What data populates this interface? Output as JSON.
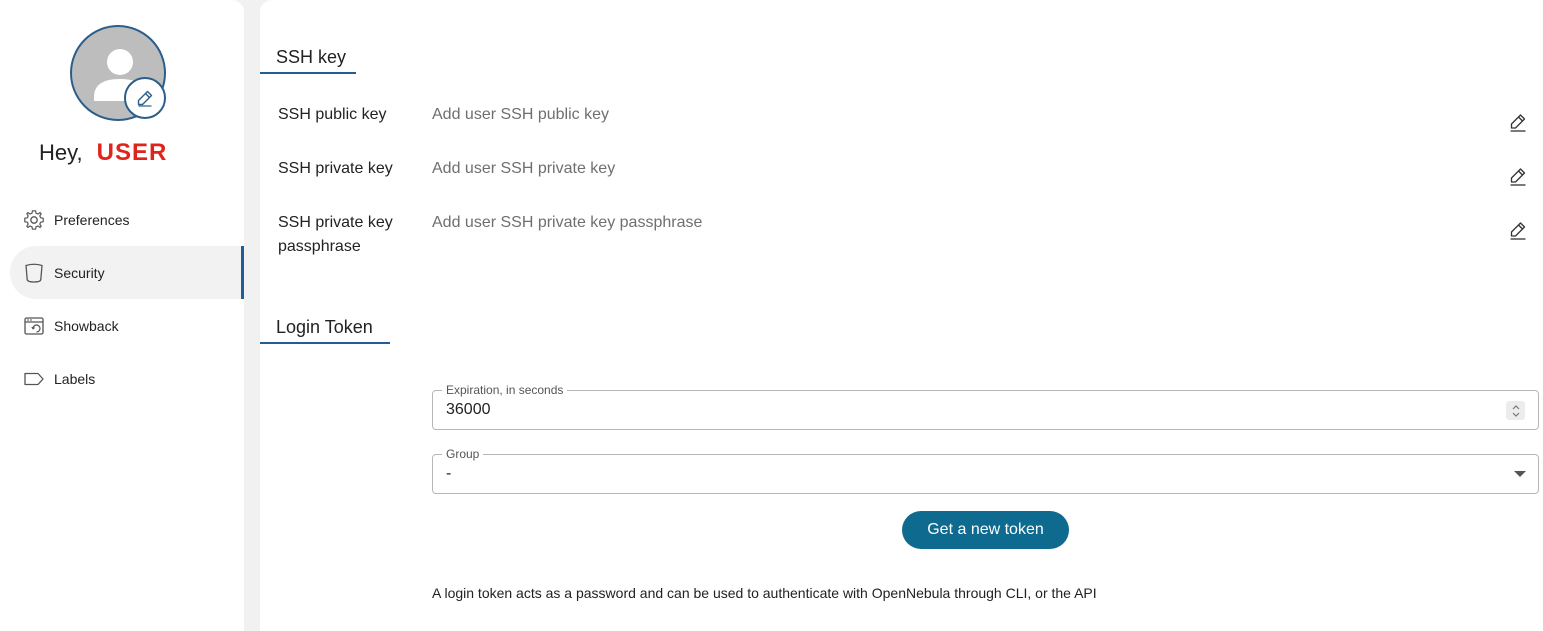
{
  "profile": {
    "greeting": "Hey,",
    "user_name": "USER"
  },
  "sidebar": {
    "items": [
      {
        "label": "Preferences",
        "icon": "gear-icon",
        "active": false
      },
      {
        "label": "Security",
        "icon": "shield-icon",
        "active": true
      },
      {
        "label": "Showback",
        "icon": "calendar-refresh-icon",
        "active": false
      },
      {
        "label": "Labels",
        "icon": "label-tag-icon",
        "active": false
      }
    ]
  },
  "ssh": {
    "title": "SSH key",
    "rows": [
      {
        "label": "SSH public key",
        "value": "Add user SSH public key"
      },
      {
        "label": "SSH private key",
        "value": "Add user SSH private key"
      },
      {
        "label": "SSH private key passphrase",
        "value": "Add user SSH private key passphrase"
      }
    ]
  },
  "login_token": {
    "title": "Login Token",
    "expiration": {
      "label": "Expiration, in seconds",
      "value": "36000"
    },
    "group": {
      "label": "Group",
      "value": "-"
    },
    "button_label": "Get a new token",
    "note": "A login token acts as a password and can be used to authenticate with OpenNebula through CLI, or the API"
  },
  "colors": {
    "accent": "#1f5e96",
    "button": "#0f6a8f",
    "user_name": "#e0241c"
  }
}
